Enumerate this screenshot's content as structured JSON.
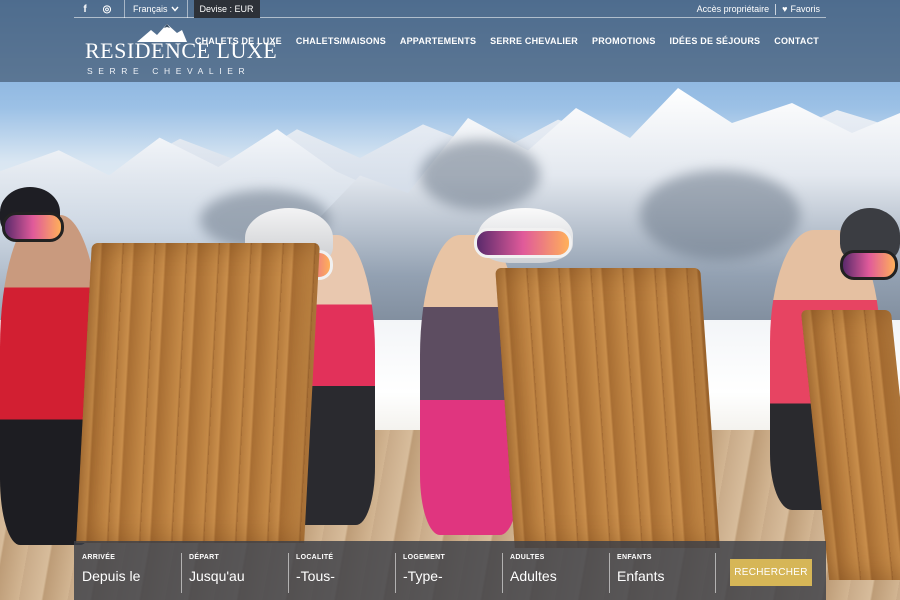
{
  "topbar": {
    "social": [
      {
        "name": "facebook-icon",
        "glyph": "f"
      },
      {
        "name": "instagram-icon",
        "glyph": "◎"
      }
    ],
    "language": "Français",
    "currency": "Devise : EUR",
    "owner_access": "Accès propriétaire",
    "favorites": "Favoris"
  },
  "logo": {
    "title": "RESIDENCE LUXE",
    "subtitle": "SERRE CHEVALIER"
  },
  "nav": {
    "items": [
      "CHALETS DE LUXE",
      "CHALETS/MAISONS",
      "APPARTEMENTS",
      "SERRE CHEVALIER",
      "PROMOTIONS",
      "IDÉES DE SÉJOURS",
      "CONTACT"
    ]
  },
  "search": {
    "fields": [
      {
        "label": "ARRIVÉE",
        "value": "Depuis le"
      },
      {
        "label": "DÉPART",
        "value": "Jusqu'au"
      },
      {
        "label": "LOCALITÉ",
        "value": "-Tous-"
      },
      {
        "label": "LOGEMENT",
        "value": "-Type-"
      },
      {
        "label": "ADULTES",
        "value": "Adultes"
      },
      {
        "label": "ENFANTS",
        "value": "Enfants"
      }
    ],
    "button": "RECHERCHER"
  },
  "colors": {
    "accent": "#d6b657",
    "header_overlay": "#3a4e64",
    "search_bg": "#3c4048"
  }
}
